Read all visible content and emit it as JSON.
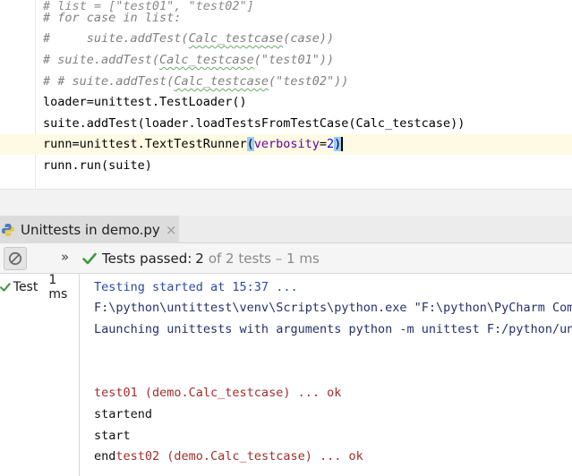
{
  "editor": {
    "lines": [
      {
        "text": "# for case in list:"
      },
      {
        "text": "#     suite.addTest(Calc_testcase(case))"
      },
      {
        "text": "# suite.addTest(Calc_testcase(\"test01\"))"
      },
      {
        "text": "# # suite.addTest(Calc_testcase(\"test02\"))"
      },
      {
        "text": "loader=unittest.TestLoader()"
      },
      {
        "text": "suite.addTest(loader.loadTestsFromTestCase(Calc_testcase))"
      },
      {
        "text": "runn=unittest.TextTestRunner(verbosity=2)"
      },
      {
        "text": "runn.run(suite)"
      }
    ],
    "current_line": {
      "prefix": "runn=unittest.TextTestRunner",
      "open_paren": "(",
      "param": "verbosity",
      "equals": "=",
      "value": "2",
      "close_paren": ")"
    }
  },
  "run_panel": {
    "tab_title": "Unittests in demo.py",
    "close_glyph": "×",
    "toolbar": {
      "more_glyph": "»",
      "status_passed": "Tests passed:",
      "status_count": "2",
      "status_rest": "of 2 tests – 1 ms"
    },
    "tree": {
      "item_label": "Test",
      "item_time": "1 ms"
    },
    "console": [
      {
        "text": "Testing started at 15:37 ...",
        "style": "blue"
      },
      {
        "text": "F:\\python\\untittest\\venv\\Scripts\\python.exe \"F:\\python\\PyCharm Community",
        "style": "darkblue"
      },
      {
        "text": "Launching unittests with arguments python -m unittest F:/python/untittest/",
        "style": "darkblue"
      },
      {
        "text": "test01 (demo.Calc_testcase) ... ok",
        "style": "red"
      },
      {
        "text": "startend",
        "style": "black"
      },
      {
        "text": "start",
        "style": "black"
      },
      {
        "text": "endtest02 (demo.Calc_testcase) ... ok",
        "style": "black"
      }
    ]
  },
  "colors": {
    "pass_green": "#3d9a3d",
    "current_line_bg": "#fffae3",
    "comment_gray": "#808080"
  }
}
